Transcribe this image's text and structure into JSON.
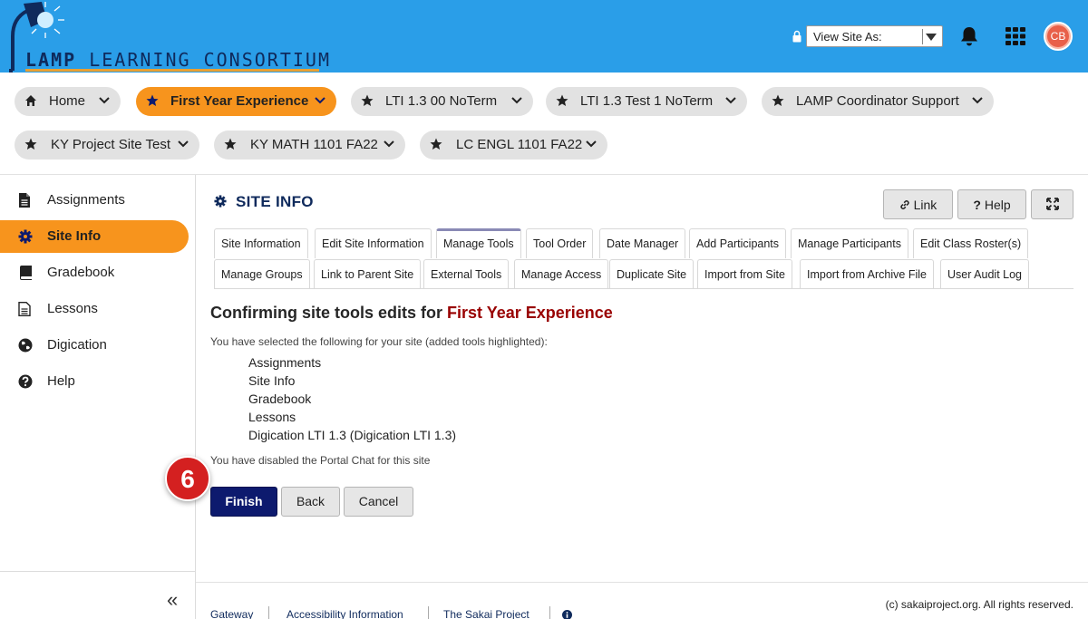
{
  "header": {
    "logo_text_bold": "LAMP",
    "logo_text_rest": "LEARNING CONSORTIUM",
    "view_site_as": "View Site As:",
    "avatar_initials": "CB"
  },
  "sites": [
    {
      "label": "Home",
      "icon": "home-icon"
    },
    {
      "label": "First Year Experience",
      "icon": "star-icon",
      "active": true
    },
    {
      "label": "LTI 1.3 00 NoTerm",
      "icon": "star-icon"
    },
    {
      "label": "LTI 1.3 Test 1 NoTerm",
      "icon": "star-icon"
    },
    {
      "label": "LAMP Coordinator Support",
      "icon": "star-icon"
    },
    {
      "label": "KY Project Site Test",
      "icon": "star-icon"
    },
    {
      "label": "KY MATH 1101 FA22",
      "icon": "star-icon"
    },
    {
      "label": "LC ENGL 1101 FA22",
      "icon": "star-icon"
    }
  ],
  "leftnav": [
    {
      "label": "Assignments",
      "icon": "file-text-icon"
    },
    {
      "label": "Site Info",
      "icon": "gear-icon",
      "active": true
    },
    {
      "label": "Gradebook",
      "icon": "book-icon"
    },
    {
      "label": "Lessons",
      "icon": "file-outline-icon"
    },
    {
      "label": "Digication",
      "icon": "globe-icon"
    },
    {
      "label": "Help",
      "icon": "question-circle-icon"
    }
  ],
  "main": {
    "title": "SITE INFO",
    "link_label": "Link",
    "help_label": "Help",
    "tabs_row1": [
      "Site Information",
      "Edit Site Information",
      "Manage Tools",
      "Tool Order",
      "Date Manager",
      "Add Participants",
      "Manage Participants",
      "Edit Class Roster(s)"
    ],
    "tabs_row2": [
      "Manage Groups",
      "Link to Parent Site",
      "External Tools",
      "Manage Access",
      "Duplicate Site",
      "Import from Site",
      "Import from Archive File",
      "User Audit Log"
    ],
    "heading_prefix": "Confirming site tools edits for",
    "heading_site": "First Year Experience",
    "selected_info": "You have selected the following for your site (added tools highlighted):",
    "tools": [
      "Assignments",
      "Site Info",
      "Gradebook",
      "Lessons",
      "Digication LTI 1.3 (Digication LTI 1.3)"
    ],
    "disabled_info": "You have disabled the Portal Chat for this site",
    "finish": "Finish",
    "back": "Back",
    "cancel": "Cancel",
    "step_badge": "6"
  },
  "footer": {
    "links": [
      "Gateway",
      "Accessibility Information",
      "The Sakai Project"
    ],
    "copyright": "(c) sakaiproject.org. All rights reserved."
  },
  "colors": {
    "header_bg": "#2a9ee8",
    "accent_orange": "#f7941d",
    "primary_navy": "#0d1a6e",
    "site_red": "#990000"
  }
}
